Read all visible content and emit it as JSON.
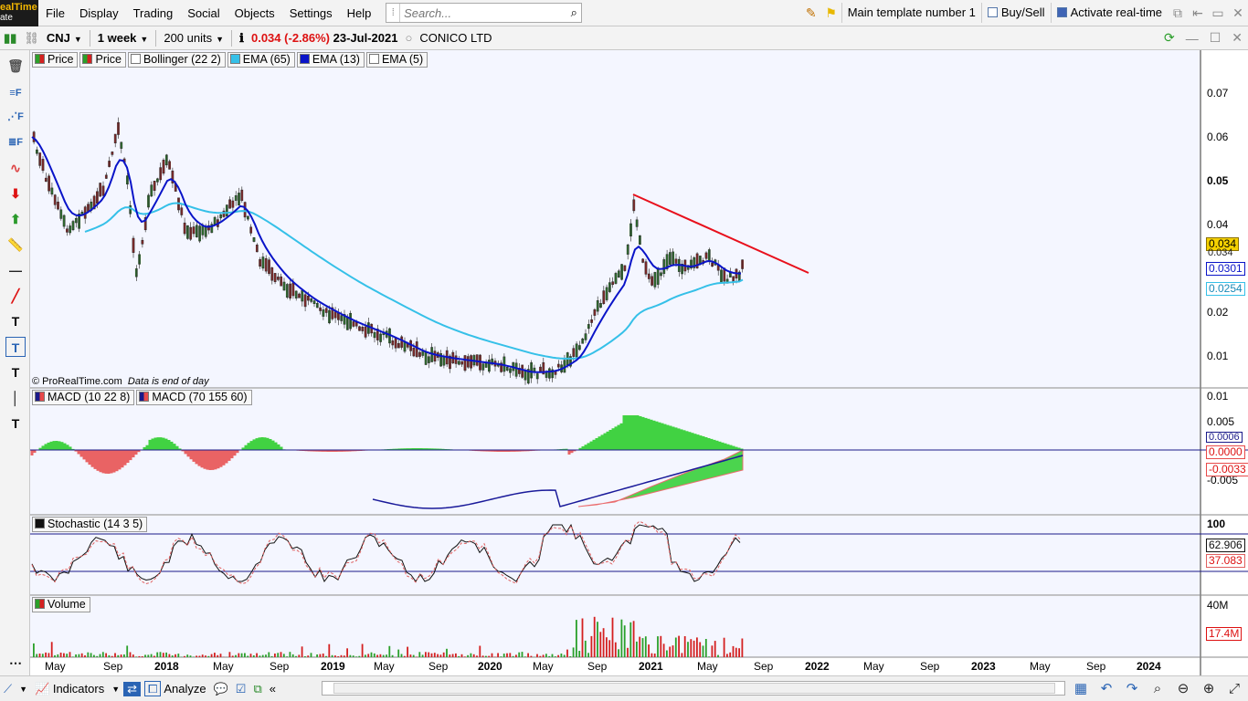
{
  "app": {
    "brand_line1": "ealTime",
    "brand_line2": "ate"
  },
  "menu": [
    "File",
    "Display",
    "Trading",
    "Social",
    "Objects",
    "Settings",
    "Help"
  ],
  "search": {
    "placeholder": "Search..."
  },
  "topbar": {
    "template": "Main template number 1",
    "buy_sell": "Buy/Sell",
    "activate": "Activate real-time"
  },
  "instrument": {
    "symbol": "CNJ",
    "timeframe": "1 week",
    "units": "200 units",
    "price": "0.034",
    "change": "(-2.86%)",
    "date": "23-Jul-2021",
    "name": "CONICO LTD"
  },
  "legends": {
    "price_panel": [
      "Price",
      "Price",
      "Bollinger (22 2)",
      "EMA (65)",
      "EMA (13)",
      "EMA (5)"
    ],
    "macd_panel": [
      "MACD (10 22 8)",
      "MACD (70 155 60)"
    ],
    "stoch_panel": [
      "Stochastic (14 3 5)"
    ],
    "volume_panel": [
      "Volume"
    ]
  },
  "copyright": {
    "owner": "© ProRealTime.com",
    "note": "Data is end of day"
  },
  "axes": {
    "price": [
      "0.07",
      "0.06",
      "0.05",
      "0.04",
      "0.02",
      "0.01"
    ],
    "price_tags": {
      "last": "0.034",
      "last_under": "0.034",
      "ema13": "0.0301",
      "ema65": "0.0254"
    },
    "macd": [
      "0.01",
      "0.005",
      "-0.005"
    ],
    "macd_tags": {
      "a": "0.0006",
      "b": "0.0000",
      "c": "-0.0033"
    },
    "stoch": {
      "top": "100",
      "k": "62.906",
      "d": "37.083"
    },
    "volume": {
      "top": "40M",
      "last": "17.4M"
    },
    "x": [
      "May",
      "Sep",
      "2018",
      "May",
      "Sep",
      "2019",
      "May",
      "Sep",
      "2020",
      "May",
      "Sep",
      "2021",
      "May",
      "Sep",
      "2022",
      "May",
      "Sep",
      "2023",
      "May",
      "Sep",
      "2024"
    ]
  },
  "colors": {
    "ema13": "#0a14c8",
    "ema65": "#35c0e8",
    "trendline": "#e8101c",
    "bull": "#2aa02a",
    "bear": "#d42020",
    "macd_pos": "#22cc22",
    "macd_neg": "#e84a4a"
  },
  "statusbar": {
    "indicators": "Indicators",
    "analyze": "Analyze"
  }
}
